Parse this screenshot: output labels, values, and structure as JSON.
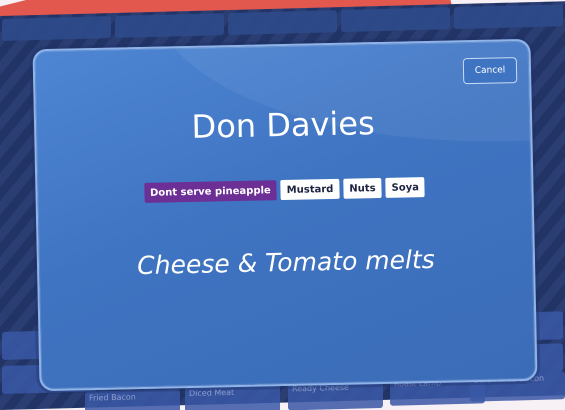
{
  "modal": {
    "cancel_label": "Cancel",
    "customer_name": "Don Davies",
    "dietary_tags": [
      "Dont serve pineapple",
      "Mustard",
      "Nuts",
      "Soya"
    ],
    "dish_name": "Cheese & Tomato melts"
  },
  "background_tiles": {
    "labels": [
      "Fried Bacon",
      "Diced Meat",
      "Ready Cheese",
      "Roast Lamb",
      "Scrambled Bacon"
    ]
  },
  "colors": {
    "modal_background": "#4a80cc",
    "primary_tag": "#6b2f95",
    "app_background": "#2b3e74",
    "accent_red": "#e2574e"
  }
}
